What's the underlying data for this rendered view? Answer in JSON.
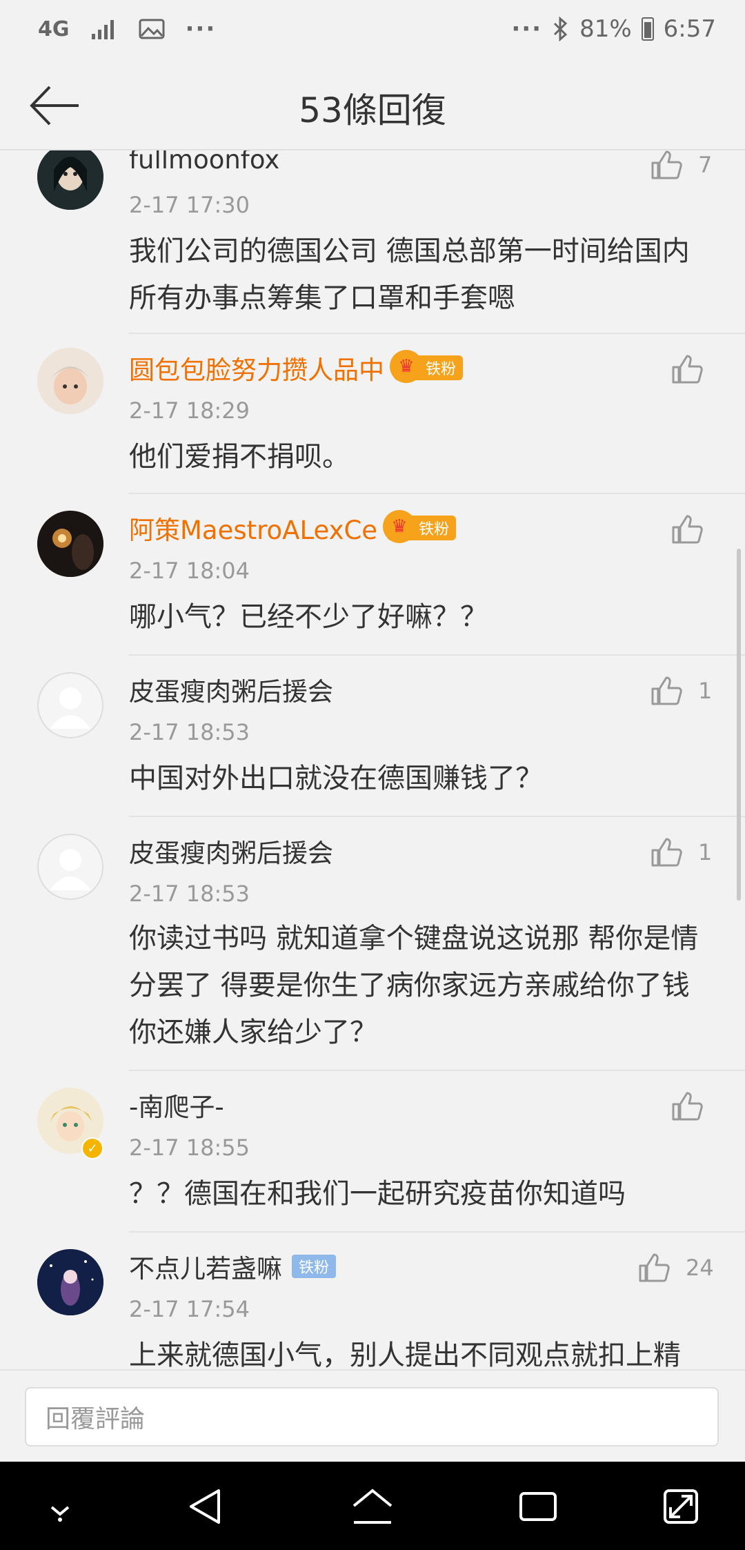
{
  "status_bar": {
    "network": "4G",
    "dots_left": "···",
    "dots_right": "···",
    "battery": "81%",
    "time": "6:57"
  },
  "header": {
    "title": "53條回復"
  },
  "comments": [
    {
      "user": "fullmoonfox",
      "time": "2-17 17:30",
      "text": "我们公司的德国公司 德国总部第一时间给国内所有办事点筹集了口罩和手套嗯",
      "likes": "7"
    },
    {
      "user": "圆包包脸努力攒人品中",
      "badge": "铁粉",
      "time": "2-17 18:29",
      "text": "他们爱捐不捐呗。",
      "likes": ""
    },
    {
      "user": "阿策MaestroALexCe",
      "badge": "铁粉",
      "time": "2-17 18:04",
      "text": "哪小气？已经不少了好嘛？？",
      "likes": ""
    },
    {
      "user": "皮蛋瘦肉粥后援会",
      "time": "2-17 18:53",
      "text": "中国对外出口就没在德国赚钱了？",
      "likes": "1"
    },
    {
      "user": "皮蛋瘦肉粥后援会",
      "time": "2-17 18:53",
      "text": "你读过书吗 就知道拿个键盘说这说那 帮你是情分罢了 得要是你生了病你家远方亲戚给你了钱你还嫌人家给少了？",
      "likes": "1"
    },
    {
      "user": "-南爬子-",
      "time": "2-17 18:55",
      "text": "？？德国在和我们一起研究疫苗你知道吗",
      "likes": ""
    },
    {
      "user": "不点儿若盏嘛",
      "badge": "铁粉",
      "time": "2-17 17:54",
      "text": "上来就德国小气，别人提出不同观点就扣上精",
      "likes": "24"
    }
  ],
  "reply": {
    "placeholder": "回覆評論"
  },
  "colors": {
    "accent_username": "#f07000",
    "badge_gold": "#f6a21a",
    "badge_blue": "#8fb9ea"
  },
  "icons": [
    "back-arrow-icon",
    "thumbs-up-icon",
    "nav-down-icon",
    "nav-back-icon",
    "nav-home-icon",
    "nav-recents-icon",
    "nav-expand-icon"
  ]
}
